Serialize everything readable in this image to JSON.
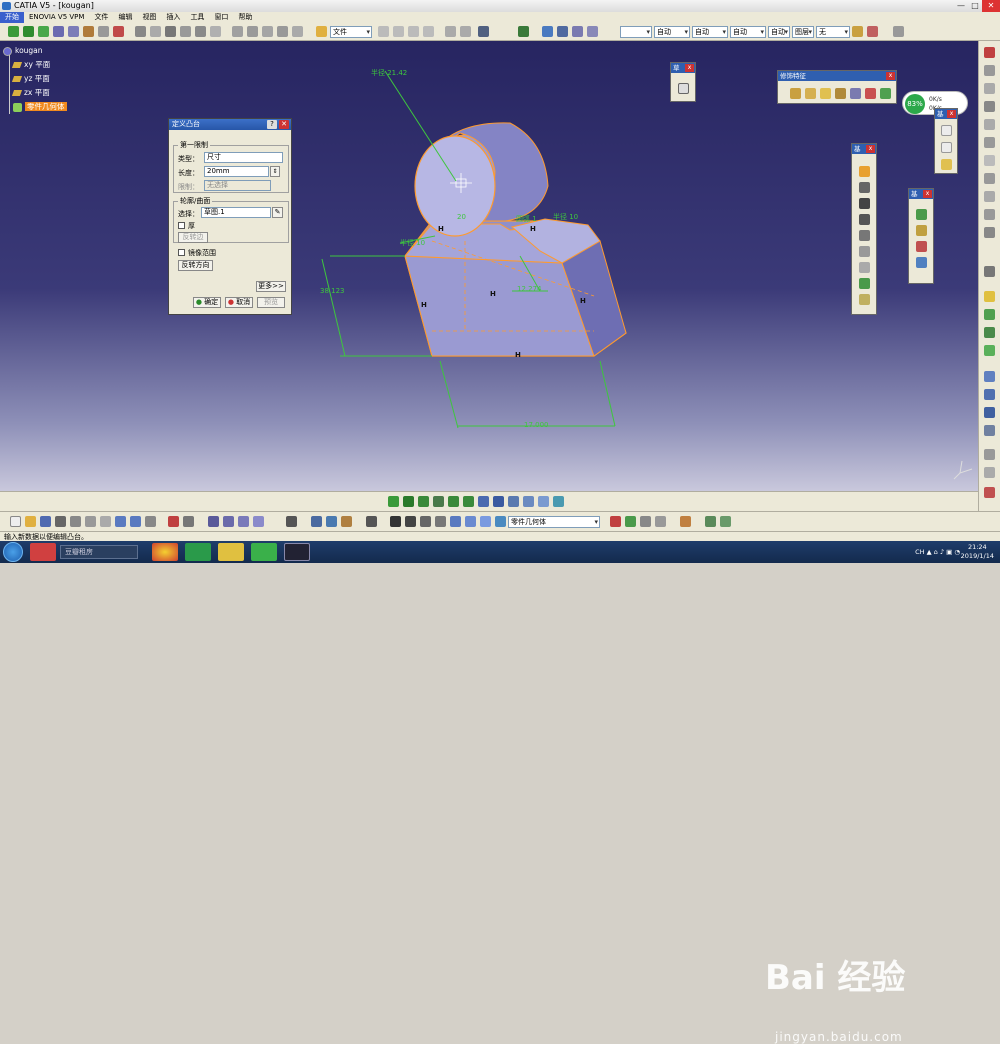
{
  "window": {
    "title": "CATIA V5 - [kougan]",
    "min": "—",
    "max": "□",
    "close": "✕"
  },
  "menu": [
    "开始",
    "ENOVIA V5 VPM",
    "文件",
    "编辑",
    "视图",
    "插入",
    "工具",
    "窗口",
    "帮助"
  ],
  "toolbar": {
    "file_combo": "文件",
    "line_combo": "",
    "color_combo": "自动",
    "weight_combo": "自动",
    "linetype_combo": "自动",
    "layer_combo": "自动",
    "layer2_combo": "图层",
    "none_combo": "无"
  },
  "tree": {
    "root": "kougan",
    "planes": [
      "xy 平面",
      "yz 平面",
      "zx 平面"
    ],
    "body": "零件几何体"
  },
  "dialog": {
    "title": "定义凸台",
    "help": "?",
    "close": "✕",
    "first_limit": "第一限制",
    "type_label": "类型：",
    "type_value": "尺寸",
    "length_label": "长度：",
    "length_value": "20mm",
    "limit_label": "限制：",
    "limit_value": "无选择",
    "profile_group": "轮廓/曲面",
    "select_label": "选择：",
    "select_value": "草图.1",
    "thick_label": "厚",
    "reverse_side": "反转边",
    "mirror_label": "镜像范围",
    "reverse_dir": "反转方向",
    "more": "更多>>",
    "ok": "确定",
    "cancel": "取消",
    "preview": "预览"
  },
  "palettes": {
    "features_title": "修饰特征",
    "small1_title": "草",
    "small2_title": "基",
    "small3_title": "基",
    "small4_title": "基"
  },
  "dimensions": {
    "radius": "半径 21.42",
    "d1": "半径 10",
    "d2": "20",
    "d3": "圆弧 1",
    "d4": "半径 10",
    "d5": "38.123",
    "d6": "12.274",
    "d7": "17.000",
    "constraint": "H"
  },
  "compass": {
    "percent": "83%",
    "up": "0K/s",
    "down": "0K/s"
  },
  "bottom": {
    "body_combo": "零件几何体"
  },
  "status": "输入新数据以便编辑凸台。",
  "taskbar": {
    "search": "豆瓣租房",
    "tray_lang": "CH",
    "time": "21:24",
    "date": "2019/1/14"
  },
  "watermark": {
    "main": "Bai 经验",
    "sub": "jingyan.baidu.com"
  },
  "colors": {
    "viewport_top": "#272561",
    "viewport_bottom": "#c9c8dc",
    "part_fill": "#8d8dc8",
    "part_edge": "#ff9a2e",
    "dimension": "#3ec63e",
    "tree_highlight": "#f08a1e"
  }
}
